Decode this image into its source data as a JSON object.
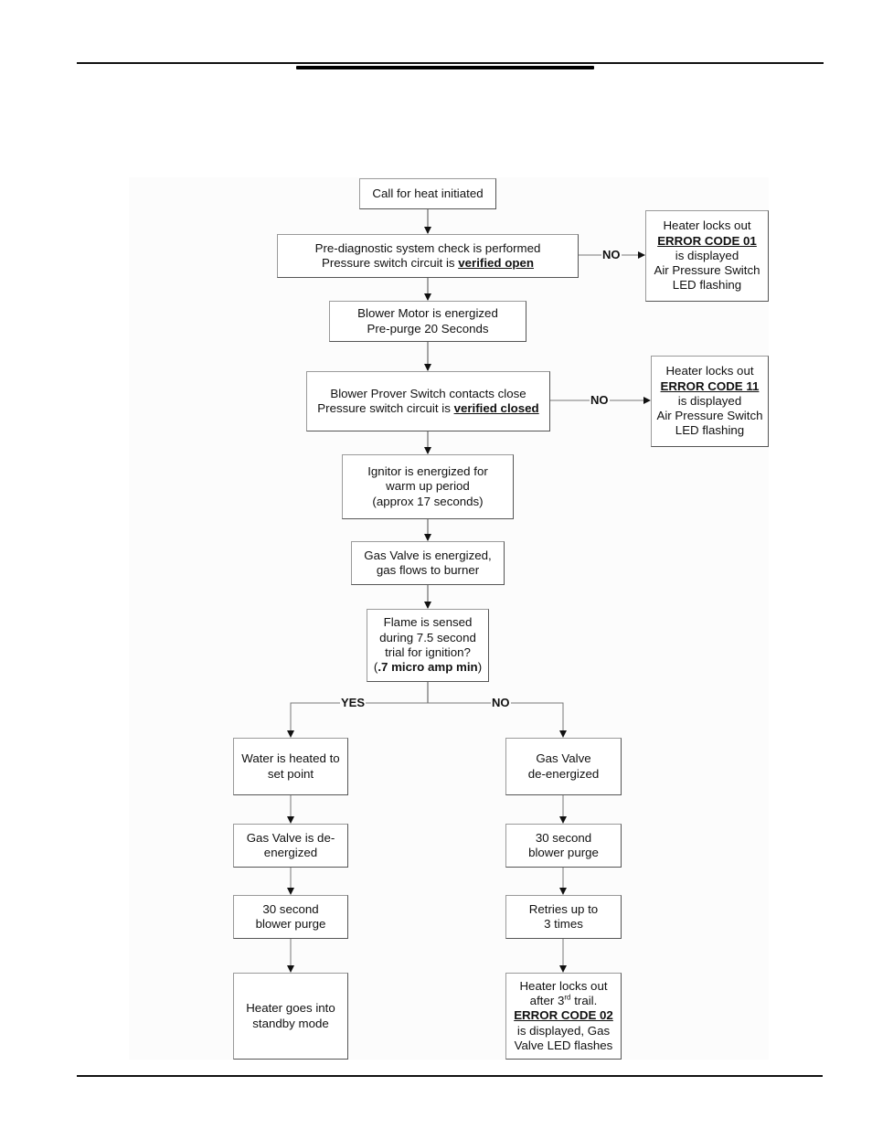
{
  "flowchart": {
    "start": "Call for heat initiated",
    "prediag": {
      "line1": "Pre-diagnostic system check is performed",
      "line2_prefix": "Pressure switch circuit is ",
      "line2_emph": "verified open"
    },
    "blower": {
      "line1": "Blower Motor is energized",
      "line2": "Pre-purge 20 Seconds"
    },
    "prover": {
      "line1": "Blower Prover Switch contacts close",
      "line2_prefix": "Pressure switch circuit is ",
      "line2_emph": "verified closed"
    },
    "ignitor": {
      "line1": "Ignitor is energized for",
      "line2": "warm up period",
      "line3": "(approx 17 seconds)"
    },
    "gasvalve": {
      "line1": "Gas Valve is energized,",
      "line2": "gas flows to burner"
    },
    "flame": {
      "line1": "Flame is sensed",
      "line2": "during 7.5 second",
      "line3": "trial for ignition?",
      "line4_open": "(",
      "line4_emph": ".7 micro amp min",
      "line4_close": ")"
    },
    "error01": {
      "line1": "Heater locks out",
      "code": "ERROR CODE 01",
      "line3": "is displayed",
      "line4": "Air Pressure Switch",
      "line5": "LED flashing"
    },
    "error11": {
      "line1": "Heater locks out",
      "code": "ERROR CODE 11",
      "line3": "is displayed",
      "line4": "Air Pressure Switch",
      "line5": "LED flashing"
    },
    "labels": {
      "no1": "NO",
      "no2": "NO",
      "yes": "YES",
      "no3": "NO"
    },
    "yes_branch": [
      {
        "line1": "Water is heated to",
        "line2": "set point"
      },
      {
        "line1": "Gas Valve is de-",
        "line2": "energized"
      },
      {
        "line1": "30 second",
        "line2": "blower purge"
      },
      {
        "line1": "Heater goes into",
        "line2": "standby mode"
      }
    ],
    "no_branch": [
      {
        "line1": "Gas Valve",
        "line2": "de-energized"
      },
      {
        "line1": "30 second",
        "line2": "blower purge"
      },
      {
        "line1": "Retries up to",
        "line2": "3 times"
      }
    ],
    "error02": {
      "line1": "Heater locks out",
      "line2_pre": "after 3",
      "line2_sup": "rd",
      "line2_post": " trail.",
      "code": "ERROR CODE 02",
      "line4": "is displayed, Gas",
      "line5": "Valve LED flashes"
    }
  }
}
